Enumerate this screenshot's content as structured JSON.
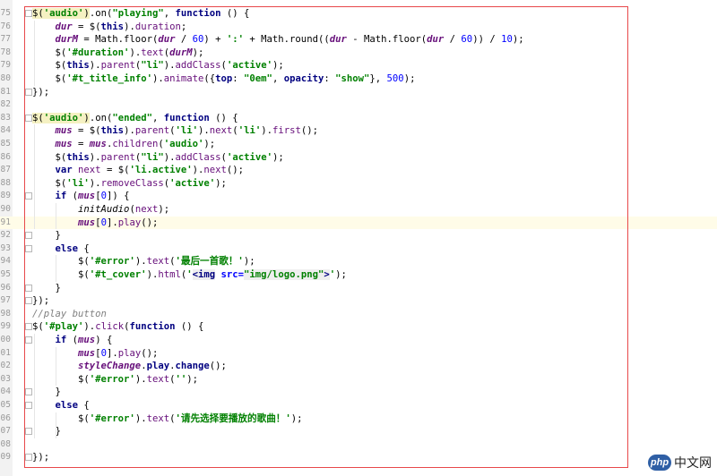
{
  "editor": {
    "watermark": "php 中文网",
    "watermark_logo": "php",
    "watermark_text": "中文网",
    "lines": [
      {
        "n": "75",
        "html": "<span class=\"jq\">$(<span class=\"str\">'audio'</span>)</span>.on(<span class=\"str\">\"playing\"</span>, <span class=\"kw\">function</span> () {"
      },
      {
        "n": "76",
        "html": "    <span class=\"var\">dur</span> = $(<span class=\"kw\">this</span>).<span class=\"prop\">duration</span>;"
      },
      {
        "n": "77",
        "html": "    <span class=\"var\">durM</span> = Math.floor(<span class=\"var\">dur</span> / <span class=\"num\">60</span>) + <span class=\"str\">':'</span> + Math.round((<span class=\"var\">dur</span> - Math.floor(<span class=\"var\">dur</span> / <span class=\"num\">60</span>)) / <span class=\"num\">10</span>);"
      },
      {
        "n": "78",
        "html": "    $(<span class=\"str\">'#duration'</span>).<span class=\"prop\">text</span>(<span class=\"var\">durM</span>);"
      },
      {
        "n": "79",
        "html": "    $(<span class=\"kw\">this</span>).<span class=\"prop\">parent</span>(<span class=\"str\">\"li\"</span>).<span class=\"prop\">addClass</span>(<span class=\"str\">'active'</span>);"
      },
      {
        "n": "80",
        "html": "    $(<span class=\"str\">'#t_title_info'</span>).<span class=\"prop\">animate</span>({<span class=\"kw\">top</span>: <span class=\"str\">\"0em\"</span>, <span class=\"kw\">opacity</span>: <span class=\"str\">\"show\"</span>}, <span class=\"num\">500</span>);"
      },
      {
        "n": "81",
        "html": "});"
      },
      {
        "n": "82",
        "html": ""
      },
      {
        "n": "83",
        "html": "<span class=\"jq\">$(<span class=\"str\">'audio'</span>)</span>.on(<span class=\"str\">\"ended\"</span>, <span class=\"kw\">function</span> () {"
      },
      {
        "n": "84",
        "html": "    <span class=\"var\">mus</span> = $(<span class=\"kw\">this</span>).<span class=\"prop\">parent</span>(<span class=\"str\">'li'</span>).<span class=\"prop\">next</span>(<span class=\"str\">'li'</span>).<span class=\"prop\">first</span>();"
      },
      {
        "n": "85",
        "html": "    <span class=\"var\">mus</span> = <span class=\"var\">mus</span>.<span class=\"prop\">children</span>(<span class=\"str\">'audio'</span>);"
      },
      {
        "n": "86",
        "html": "    $(<span class=\"kw\">this</span>).<span class=\"prop\">parent</span>(<span class=\"str\">\"li\"</span>).<span class=\"prop\">addClass</span>(<span class=\"str\">'active'</span>);"
      },
      {
        "n": "87",
        "html": "    <span class=\"kw\">var</span> <span class=\"prop\">next</span> = $(<span class=\"str\">'li.active'</span>).<span class=\"prop\">next</span>();"
      },
      {
        "n": "88",
        "html": "    $(<span class=\"str\">'li'</span>).<span class=\"prop\">removeClass</span>(<span class=\"str\">'active'</span>);"
      },
      {
        "n": "89",
        "html": "    <span class=\"kw\">if</span> (<span class=\"var\">mus</span>[<span class=\"num\">0</span>]) {"
      },
      {
        "n": "90",
        "html": "        <span class=\"ital\">initAudio</span>(<span class=\"prop\">next</span>);"
      },
      {
        "n": "91",
        "html": "        <span class=\"var\">mus</span>[<span class=\"num\">0</span>].<span class=\"prop\">play</span>();"
      },
      {
        "n": "92",
        "html": "    }"
      },
      {
        "n": "93",
        "html": "    <span class=\"kw\">else</span> {"
      },
      {
        "n": "94",
        "html": "        $(<span class=\"str\">'#error'</span>).<span class=\"prop\">text</span>(<span class=\"str\">'最后一首歌！'</span>);"
      },
      {
        "n": "95",
        "html": "        $(<span class=\"str\">'#t_cover'</span>).<span class=\"prop\">html</span>(<span class=\"str\">'</span><span class=\"tag\">&lt;img</span> <span class=\"attr\">src=</span><span class=\"attrv\">\"img/logo.png\"</span><span class=\"tag\">&gt;</span><span class=\"str\">'</span>);"
      },
      {
        "n": "96",
        "html": "    }"
      },
      {
        "n": "97",
        "html": "});"
      },
      {
        "n": "98",
        "html": "<span class=\"cmt\">//play button</span>"
      },
      {
        "n": "99",
        "html": "$(<span class=\"str\">'#play'</span>).<span class=\"prop\">click</span>(<span class=\"kw\">function</span> () {"
      },
      {
        "n": "00",
        "html": "    <span class=\"kw\">if</span> (<span class=\"var\">mus</span>) {"
      },
      {
        "n": "01",
        "html": "        <span class=\"var\">mus</span>[<span class=\"num\">0</span>].<span class=\"prop\">play</span>();"
      },
      {
        "n": "02",
        "html": "        <span class=\"var\">styleChange</span>.<span class=\"kw\">play</span>.<span class=\"kw\">change</span>();"
      },
      {
        "n": "03",
        "html": "        $(<span class=\"str\">'#error'</span>).<span class=\"prop\">text</span>(<span class=\"str\">''</span>);"
      },
      {
        "n": "04",
        "html": "    }"
      },
      {
        "n": "05",
        "html": "    <span class=\"kw\">else</span> {"
      },
      {
        "n": "06",
        "html": "        $(<span class=\"str\">'#error'</span>).<span class=\"prop\">text</span>(<span class=\"str\">'请先选择要播放的歌曲！'</span>);"
      },
      {
        "n": "07",
        "html": "    }"
      },
      {
        "n": "08",
        "html": ""
      },
      {
        "n": "09",
        "html": "});"
      }
    ]
  }
}
